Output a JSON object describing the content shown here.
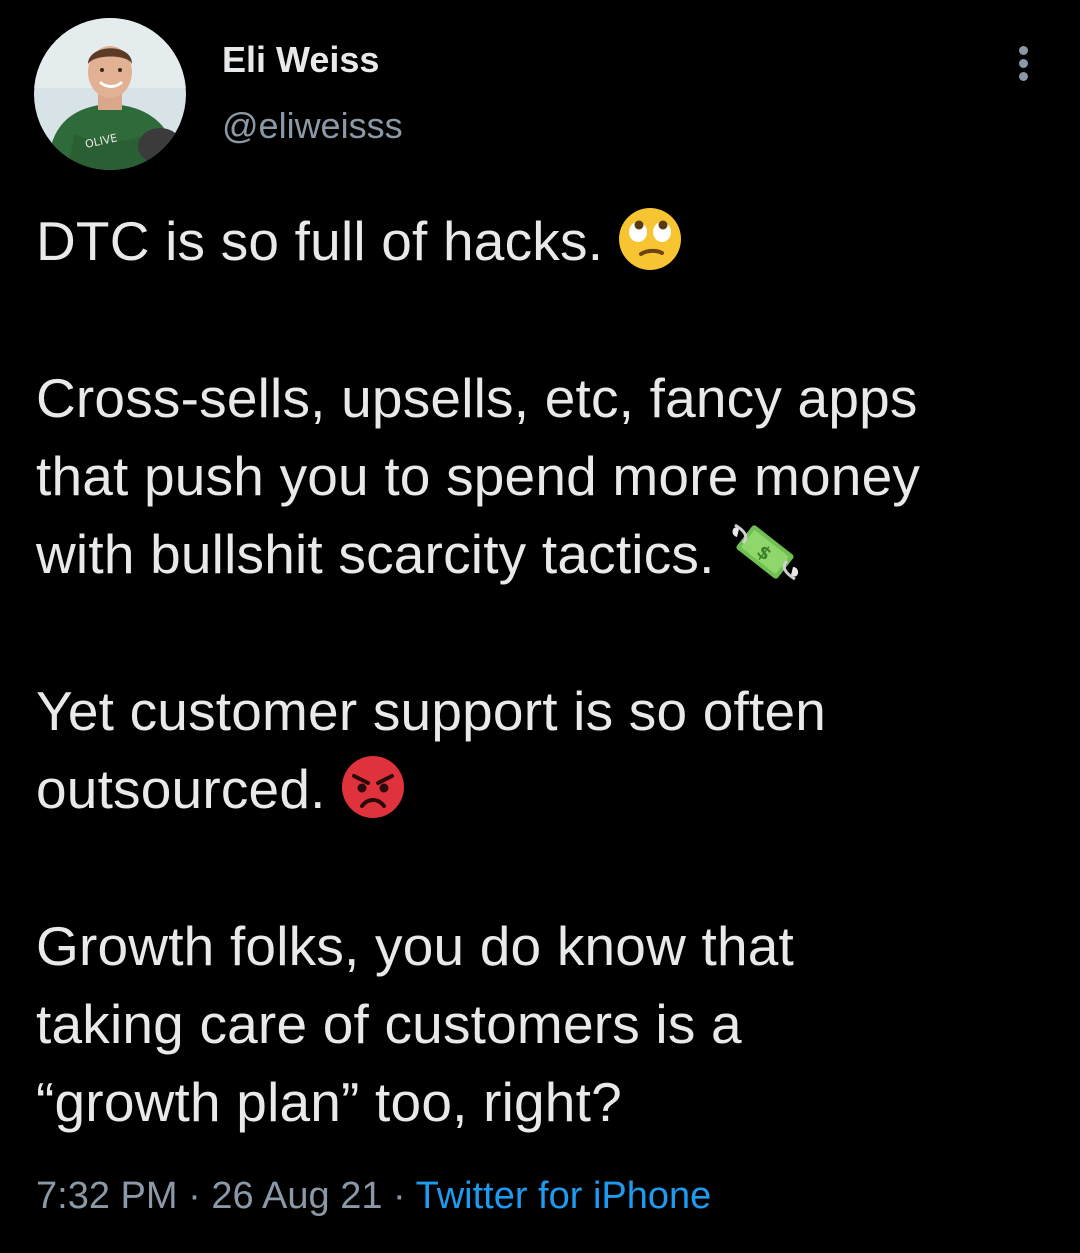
{
  "user": {
    "display_name": "Eli Weiss",
    "handle": "@eliweisss",
    "avatar_icon": "profile-photo"
  },
  "tweet": {
    "paragraphs": [
      {
        "lines": [
          "DTC is so full of hacks."
        ],
        "emoji": "face-with-rolling-eyes-icon"
      },
      {
        "lines": [
          "Cross-sells, upsells, etc, fancy apps",
          "that push you to spend more money",
          "with bullshit scarcity tactics."
        ],
        "emoji": "money-with-wings-icon"
      },
      {
        "lines": [
          "Yet customer support is so often",
          "outsourced."
        ],
        "emoji": "pouting-face-icon"
      },
      {
        "lines": [
          "Growth folks, you do know that",
          "taking care of customers is a",
          "“growth plan” too, right?"
        ]
      }
    ]
  },
  "meta": {
    "time": "7:32 PM",
    "separator": " · ",
    "date": "26 Aug 21",
    "source": "Twitter for iPhone"
  },
  "colors": {
    "background": "#000000",
    "text": "#e7e9ea",
    "secondary": "#8b98a5",
    "link": "#1d9bf0"
  }
}
